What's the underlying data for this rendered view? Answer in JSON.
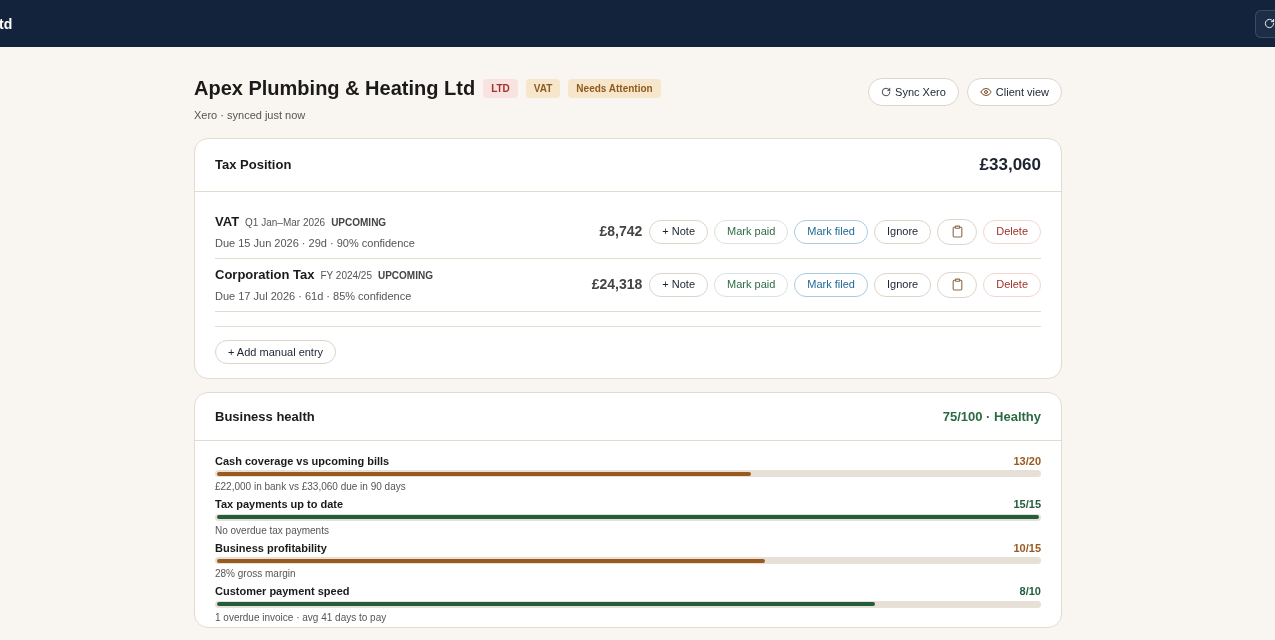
{
  "topbar": {
    "brand": "td"
  },
  "client": {
    "name": "Apex Plumbing & Heating Ltd",
    "badges": [
      {
        "label": "LTD",
        "kind": "red"
      },
      {
        "label": "VAT",
        "kind": "amber"
      },
      {
        "label": "Needs Attention",
        "kind": "amber"
      }
    ],
    "subtitle": "Xero · synced just now",
    "actions": [
      {
        "label": "Sync Xero",
        "kind": "sync"
      },
      {
        "label": "Client view",
        "kind": "view"
      }
    ]
  },
  "tax_position": {
    "title": "Tax Position",
    "total": "£33,060",
    "entries": [
      {
        "name": "VAT",
        "period": "Q1 Jan–Mar 2026",
        "status": "UPCOMING",
        "details": "Due 15 Jun 2026 · 29d · 90% confidence",
        "amount": "£8,742",
        "buttons": [
          {
            "label": "+ Note",
            "kind": "plain"
          },
          {
            "label": "Mark paid",
            "kind": "green"
          },
          {
            "label": "Mark filed",
            "kind": "blue"
          },
          {
            "label": "Ignore",
            "kind": "plain"
          },
          {
            "kind": "clipboard"
          },
          {
            "label": "Delete",
            "kind": "red"
          }
        ]
      },
      {
        "name": "Corporation Tax",
        "period": "FY 2024/25",
        "status": "UPCOMING",
        "details": "Due 17 Jul 2026 · 61d · 85% confidence",
        "amount": "£24,318",
        "buttons": [
          {
            "label": "+ Note",
            "kind": "plain"
          },
          {
            "label": "Mark paid",
            "kind": "green"
          },
          {
            "label": "Mark filed",
            "kind": "blue"
          },
          {
            "label": "Ignore",
            "kind": "plain"
          },
          {
            "kind": "clipboard"
          },
          {
            "label": "Delete",
            "kind": "red"
          }
        ]
      }
    ],
    "add_button": "+ Add manual entry"
  },
  "business_health": {
    "title": "Business health",
    "score": "75/100 · Healthy",
    "metrics": [
      {
        "name": "Cash coverage vs upcoming bills",
        "score": "13/20",
        "level": 0.65,
        "color": "#9a5a1f",
        "note": "£22,000 in bank vs £33,060 due in 90 days"
      },
      {
        "name": "Tax payments up to date",
        "score": "15/15",
        "level": 1,
        "color": "#245c3e",
        "note": "No overdue tax payments"
      },
      {
        "name": "Business profitability",
        "score": "10/15",
        "level": 0.667,
        "color": "#9a5a1f",
        "note": "28% gross margin"
      },
      {
        "name": "Customer payment speed",
        "score": "8/10",
        "level": 0.8,
        "color": "#245c3e",
        "note": "1 overdue invoice · avg 41 days to pay"
      }
    ]
  }
}
